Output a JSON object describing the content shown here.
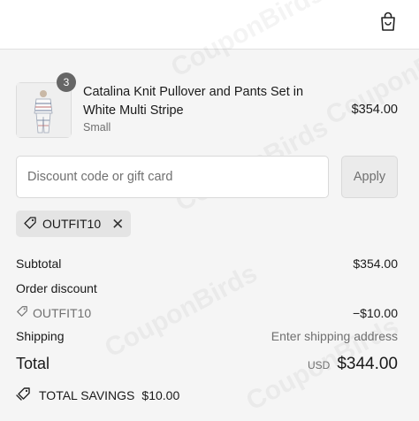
{
  "watermark": "CouponBirds",
  "header": {
    "bag_icon": "shopping-bag-icon"
  },
  "product": {
    "quantity": "3",
    "name": "Catalina Knit Pullover and Pants Set in White Multi Stripe",
    "variant": "Small",
    "price": "$354.00"
  },
  "discount": {
    "placeholder": "Discount code or gift card",
    "value": "",
    "apply_label": "Apply"
  },
  "applied_code": {
    "code": "OUTFIT10",
    "tag_icon": "tag-icon",
    "remove_icon": "close-icon"
  },
  "summary": {
    "subtotal_label": "Subtotal",
    "subtotal_value": "$354.00",
    "order_discount_label": "Order discount",
    "discount_code": "OUTFIT10",
    "discount_value": "−$10.00",
    "shipping_label": "Shipping",
    "shipping_value": "Enter shipping address",
    "total_label": "Total",
    "currency": "USD",
    "total_value": "$344.00"
  },
  "savings": {
    "label": "TOTAL SAVINGS",
    "value": "$10.00",
    "icon": "savings-tag-icon"
  }
}
